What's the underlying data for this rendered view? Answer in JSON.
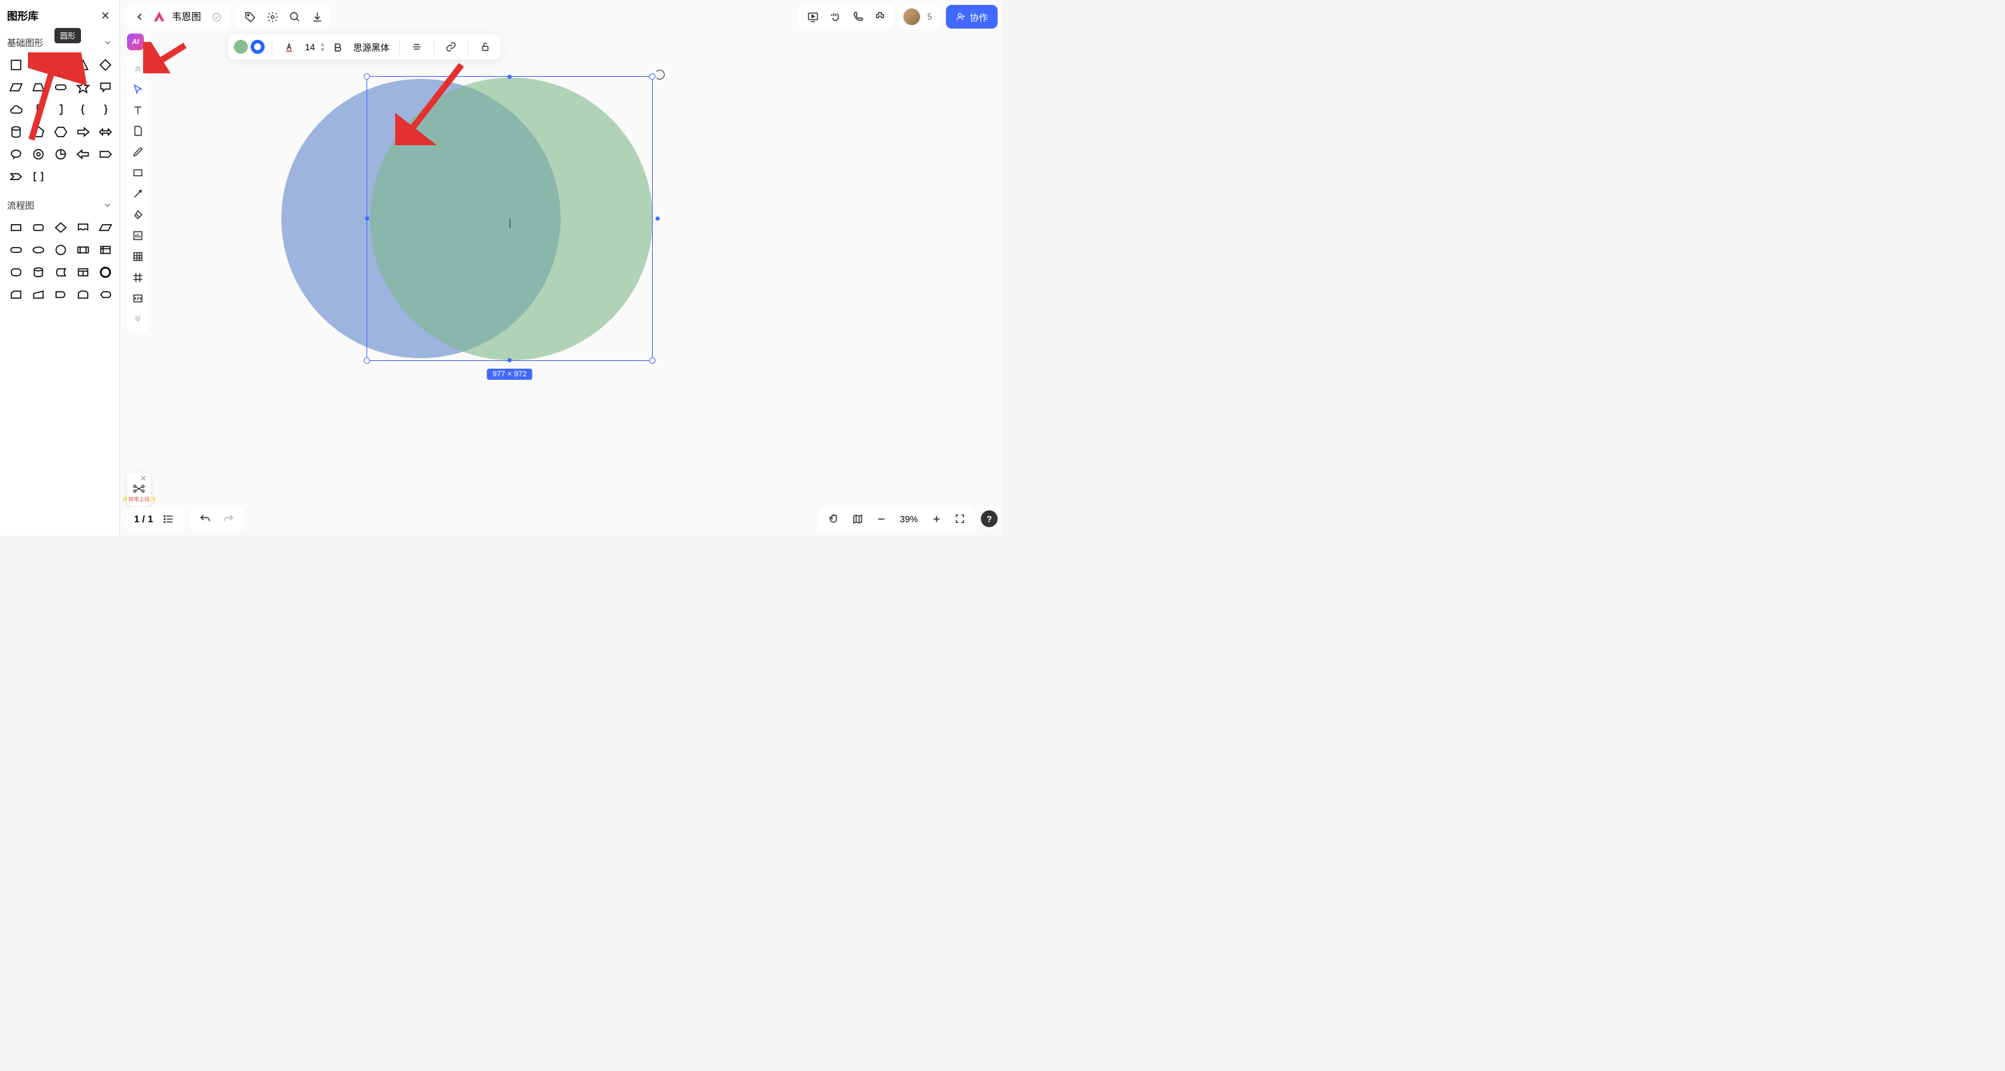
{
  "sidebar": {
    "title": "图形库",
    "sections": {
      "basic": {
        "title": "基础图形"
      },
      "flowchart": {
        "title": "流程图"
      }
    },
    "tooltip": "圆形"
  },
  "topbar": {
    "doc_title": "韦恩图",
    "user_count": "5",
    "collab_label": "协作"
  },
  "ai_badge": "AI",
  "formatbar": {
    "font_size": "14",
    "font_family": "思源黑体"
  },
  "selection": {
    "size_label": "977 × 972"
  },
  "shortcut": {
    "label": "效率上线"
  },
  "bottombar": {
    "page": "1 / 1",
    "zoom": "39%"
  }
}
